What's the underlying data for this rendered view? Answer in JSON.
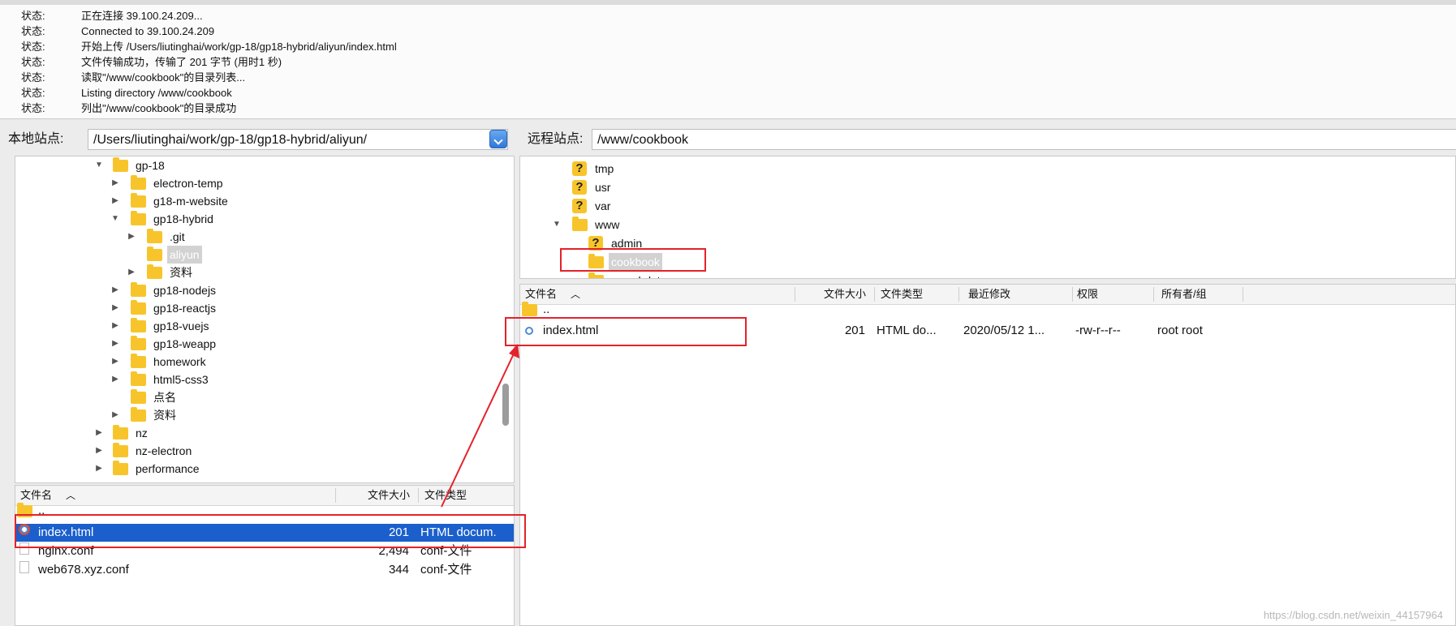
{
  "log": {
    "label": "状态:",
    "messages": [
      "正在连接 39.100.24.209...",
      "Connected to 39.100.24.209",
      "开始上传 /Users/liutinghai/work/gp-18/gp18-hybrid/aliyun/index.html",
      "文件传输成功，传输了 201 字节 (用时1 秒)",
      "读取\"/www/cookbook\"的目录列表...",
      "Listing directory /www/cookbook",
      "列出\"/www/cookbook\"的目录成功"
    ]
  },
  "local": {
    "site_label": "本地站点:",
    "path": "/Users/liutinghai/work/gp-18/gp18-hybrid/aliyun/",
    "tree": [
      {
        "name": "gp-18"
      },
      {
        "name": "electron-temp"
      },
      {
        "name": "g18-m-website"
      },
      {
        "name": "gp18-hybrid"
      },
      {
        "name": ".git"
      },
      {
        "name": "aliyun"
      },
      {
        "name": "资料"
      },
      {
        "name": "gp18-nodejs"
      },
      {
        "name": "gp18-reactjs"
      },
      {
        "name": "gp18-vuejs"
      },
      {
        "name": "gp18-weapp"
      },
      {
        "name": "homework"
      },
      {
        "name": "html5-css3"
      },
      {
        "name": "点名"
      },
      {
        "name": "资料"
      },
      {
        "name": "nz"
      },
      {
        "name": "nz-electron"
      },
      {
        "name": "performance"
      }
    ],
    "list": {
      "columns": {
        "name": "文件名",
        "size": "文件大小",
        "type": "文件类型"
      },
      "parent": "..",
      "files": [
        {
          "name": "index.html",
          "size": "201",
          "type": "HTML docum."
        },
        {
          "name": "nginx.conf",
          "size": "2,494",
          "type": "conf-文件"
        },
        {
          "name": "web678.xyz.conf",
          "size": "344",
          "type": "conf-文件"
        }
      ]
    }
  },
  "remote": {
    "site_label": "远程站点:",
    "path": "/www/cookbook",
    "tree": [
      {
        "name": "tmp"
      },
      {
        "name": "usr"
      },
      {
        "name": "var"
      },
      {
        "name": "www"
      },
      {
        "name": "admin"
      },
      {
        "name": "cookbook"
      },
      {
        "name": "mysql-data"
      }
    ],
    "list": {
      "columns": {
        "name": "文件名",
        "size": "文件大小",
        "type": "文件类型",
        "modified": "最近修改",
        "perms": "权限",
        "owner": "所有者/组"
      },
      "parent": "..",
      "files": [
        {
          "name": "index.html",
          "size": "201",
          "type": "HTML do...",
          "modified": "2020/05/12 1...",
          "perms": "-rw-r--r--",
          "owner": "root root"
        }
      ]
    }
  },
  "watermark": "https://blog.csdn.net/weixin_44157964",
  "colors": {
    "highlight": "#e4222a",
    "selection": "#1b5fcc",
    "folder": "#f7c52b"
  }
}
